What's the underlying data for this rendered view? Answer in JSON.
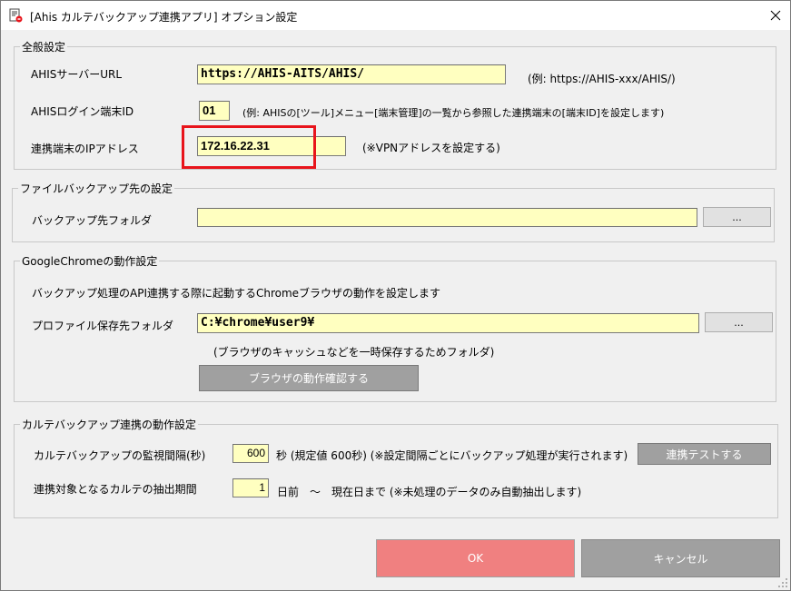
{
  "window": {
    "title": "[Ahis カルテバックアップ連携アプリ] オプション設定",
    "close_glyph": "✕"
  },
  "general": {
    "legend": "全般設定",
    "server_url_label": "AHISサーバーURL",
    "server_url_value": "https://AHIS-AITS/AHIS/",
    "server_url_hint": "(例: https://AHIS-xxx/AHIS/)",
    "login_id_label": "AHISログイン端末ID",
    "login_id_value": "01",
    "login_id_hint": "(例: AHISの[ツール]メニュー[端末管理]の一覧から参照した連携端末の[端末ID]を設定します)",
    "ip_label": "連携端末のIPアドレス",
    "ip_value": "172.16.22.31",
    "ip_hint": "(※VPNアドレスを設定する)"
  },
  "backup": {
    "legend": "ファイルバックアップ先の設定",
    "folder_label": "バックアップ先フォルダ",
    "folder_value": "",
    "browse_label": "..."
  },
  "chrome": {
    "legend": "GoogleChromeの動作設定",
    "description": "バックアップ処理のAPI連携する際に起動するChromeブラウザの動作を設定します",
    "profile_label": "プロファイル保存先フォルダ",
    "profile_value": "C:¥chrome¥user9¥",
    "browse_label": "...",
    "profile_hint": "(ブラウザのキャッシュなどを一時保存するためフォルダ)",
    "check_button": "ブラウザの動作確認する"
  },
  "karte": {
    "legend": "カルテバックアップ連携の動作設定",
    "interval_label": "カルテバックアップの監視間隔(秒)",
    "interval_value": "600",
    "interval_hint": "秒 (規定値 600秒) (※設定間隔ごとにバックアップ処理が実行されます)",
    "test_button": "連携テストする",
    "period_label": "連携対象となるカルテの抽出期間",
    "period_value": "1",
    "period_hint": "日前　～　現在日まで (※未処理のデータのみ自動抽出します)"
  },
  "footer": {
    "ok_label": "OK",
    "cancel_label": "キャンセル"
  },
  "colors": {
    "input_bg": "#ffffc0",
    "highlight": "#e8141b",
    "ok_bg": "#f08080",
    "gray_button": "#a0a0a0"
  }
}
